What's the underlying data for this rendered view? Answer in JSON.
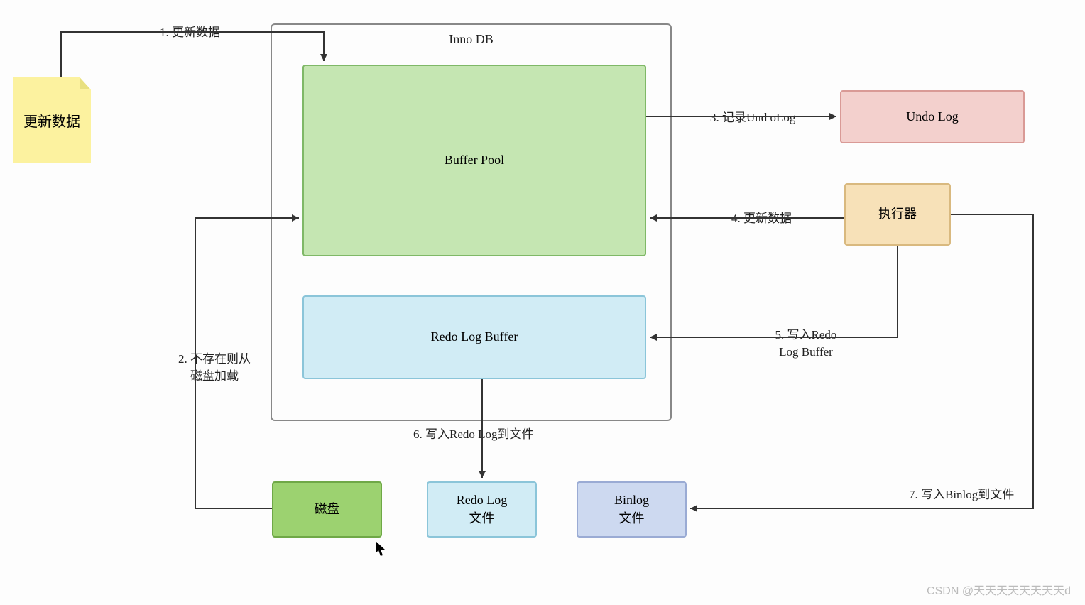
{
  "note": {
    "label": "更新数据"
  },
  "container": {
    "label": "Inno DB"
  },
  "buffer_pool": {
    "label": "Buffer Pool"
  },
  "redo_buffer": {
    "label": "Redo Log Buffer"
  },
  "undo_log": {
    "label": "Undo Log"
  },
  "executor": {
    "label": "执行器"
  },
  "disk": {
    "label": "磁盘"
  },
  "redolog_file": {
    "line1": "Redo Log",
    "line2": "文件"
  },
  "binlog_file": {
    "line1": "Binlog",
    "line2": "文件"
  },
  "edges": {
    "e1": "1. 更新数据",
    "e2_line1": "2. 不存在则从",
    "e2_line2": "磁盘加载",
    "e3": "3. 记录Und oLog",
    "e4": "4. 更新数据",
    "e5_line1": "5. 写入Redo",
    "e5_line2": "Log Buffer",
    "e6": "6. 写入Redo Log到文件",
    "e7": "7. 写入Binlog到文件"
  },
  "watermark": "CSDN @天天天天天天天天d"
}
